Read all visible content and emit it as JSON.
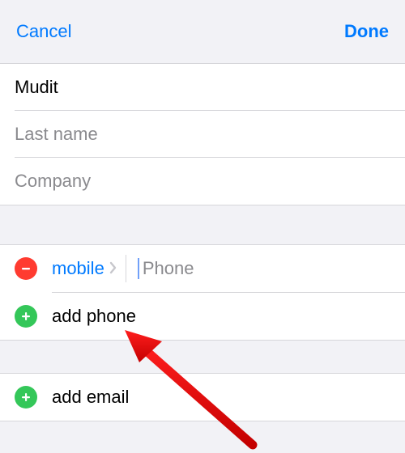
{
  "nav": {
    "cancel": "Cancel",
    "done": "Done"
  },
  "name_fields": {
    "first_name_value": "Mudit",
    "last_name_placeholder": "Last name",
    "company_placeholder": "Company"
  },
  "phone_section": {
    "type_label": "mobile",
    "phone_placeholder": "Phone",
    "add_phone_label": "add phone"
  },
  "email_section": {
    "add_email_label": "add email"
  },
  "icons": {
    "remove": "remove-icon",
    "add": "add-icon",
    "chevron": "chevron-right-icon"
  }
}
